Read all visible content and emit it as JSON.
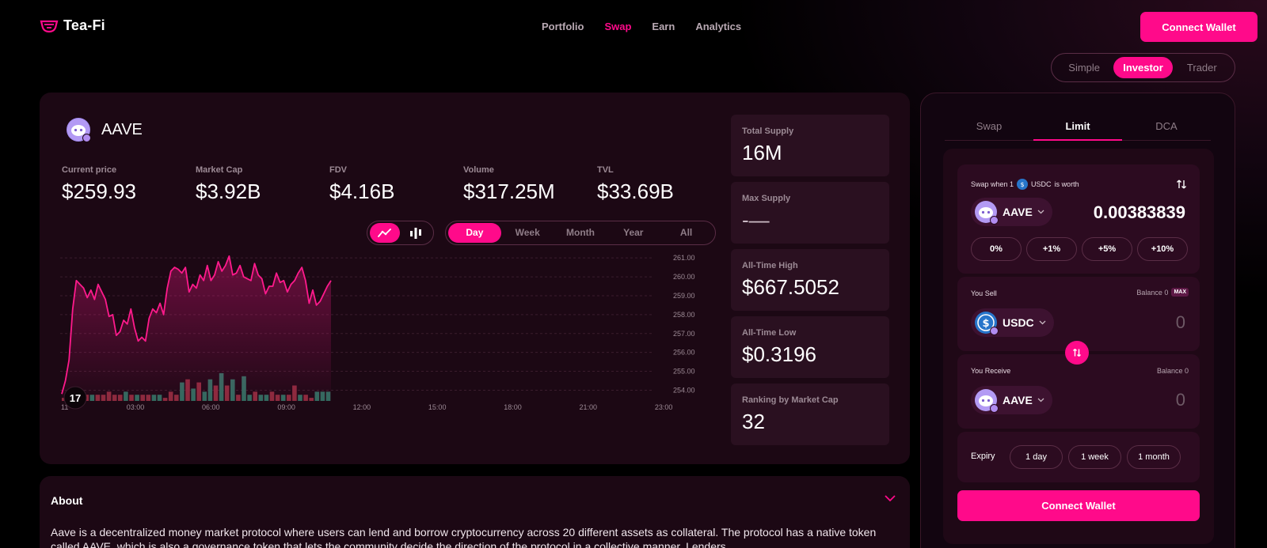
{
  "brand": {
    "name_part1": "Tea",
    "name_part2": "-Fi",
    "accent": "#ff0a8a"
  },
  "nav": {
    "items": [
      "Portfolio",
      "Swap",
      "Earn",
      "Analytics"
    ],
    "active": "Swap"
  },
  "header": {
    "connect_label": "Connect Wallet"
  },
  "modes": {
    "items": [
      "Simple",
      "Investor",
      "Trader"
    ],
    "active": "Investor"
  },
  "token": {
    "symbol": "AAVE",
    "stats": [
      {
        "label": "Current price",
        "value": "$259.93"
      },
      {
        "label": "Market Cap",
        "value": "$3.92B"
      },
      {
        "label": "FDV",
        "value": "$4.16B"
      },
      {
        "label": "Volume",
        "value": "$317.25M"
      },
      {
        "label": "TVL",
        "value": "$33.69B"
      }
    ],
    "side_stats": [
      {
        "label": "Total Supply",
        "value": "16M"
      },
      {
        "label": "Max Supply",
        "value": "-—"
      },
      {
        "label": "All-Time High",
        "value": "$667.5052"
      },
      {
        "label": "All-Time Low",
        "value": "$0.3196"
      },
      {
        "label": "Ranking by Market Cap",
        "value": "32"
      }
    ]
  },
  "chart_controls": {
    "types": [
      "line-chart-icon",
      "candle-chart-icon"
    ],
    "active_type": "line-chart-icon",
    "ranges": [
      "Day",
      "Week",
      "Month",
      "Year",
      "All"
    ],
    "active_range": "Day"
  },
  "chart_data": {
    "type": "line",
    "y_ticks": [
      "261.00",
      "260.00",
      "259.00",
      "258.00",
      "257.00",
      "256.00",
      "255.00",
      "254.00"
    ],
    "ylim": [
      253.6,
      261.3
    ],
    "x_ticks": [
      "03:00",
      "06:00",
      "09:00",
      "12:00",
      "15:00",
      "18:00",
      "21:00",
      "23:00"
    ],
    "x_first_tick_partial": "11",
    "price": [
      253.8,
      254.5,
      255.6,
      258.3,
      259.8,
      259.6,
      259.4,
      258.9,
      259.3,
      258.8,
      259.6,
      259.2,
      258.8,
      257.9,
      258.0,
      256.9,
      257.1,
      257.7,
      257.5,
      258.3,
      257.3,
      256.6,
      256.8,
      256.6,
      257.8,
      258.3,
      258.1,
      258.6,
      258.0,
      259.4,
      260.3,
      260.5,
      260.4,
      260.2,
      260.5,
      259.2,
      259.6,
      259.4,
      260.1,
      259.8,
      260.6,
      259.8,
      260.1,
      260.8,
      260.3,
      260.6,
      261.1,
      260.1,
      260.2,
      260.6,
      260.0,
      259.9,
      259.8,
      260.7,
      260.1,
      259.9,
      259.1,
      259.5,
      259.5,
      260.2,
      259.7,
      259.8,
      259.2,
      259.6,
      259.8,
      260.2,
      260.5,
      259.8,
      258.6,
      259.3,
      258.5,
      258.7,
      259.1,
      259.5,
      259.8
    ],
    "volume_bars": [
      {
        "v": 1,
        "up": false
      },
      {
        "v": 2,
        "up": false
      },
      {
        "v": 2,
        "up": false
      },
      {
        "v": 2,
        "up": true
      },
      {
        "v": 2,
        "up": false
      },
      {
        "v": 2,
        "up": true
      },
      {
        "v": 2,
        "up": false
      },
      {
        "v": 2,
        "up": false
      },
      {
        "v": 3,
        "up": false
      },
      {
        "v": 2,
        "up": false
      },
      {
        "v": 2,
        "up": false
      },
      {
        "v": 3,
        "up": true
      },
      {
        "v": 2,
        "up": false
      },
      {
        "v": 2,
        "up": true
      },
      {
        "v": 2,
        "up": false
      },
      {
        "v": 2,
        "up": false
      },
      {
        "v": 2,
        "up": true
      },
      {
        "v": 2,
        "up": true
      },
      {
        "v": 1,
        "up": false
      },
      {
        "v": 3,
        "up": false
      },
      {
        "v": 2,
        "up": false
      },
      {
        "v": 6,
        "up": true
      },
      {
        "v": 7,
        "up": false
      },
      {
        "v": 4,
        "up": true
      },
      {
        "v": 6,
        "up": false
      },
      {
        "v": 3,
        "up": true
      },
      {
        "v": 7,
        "up": true
      },
      {
        "v": 5,
        "up": false
      },
      {
        "v": 9,
        "up": true
      },
      {
        "v": 5,
        "up": false
      },
      {
        "v": 7,
        "up": true
      },
      {
        "v": 2,
        "up": false
      },
      {
        "v": 8,
        "up": true
      },
      {
        "v": 2,
        "up": true
      },
      {
        "v": 3,
        "up": false
      },
      {
        "v": 2,
        "up": true
      },
      {
        "v": 2,
        "up": true
      },
      {
        "v": 3,
        "up": false
      },
      {
        "v": 2,
        "up": false
      },
      {
        "v": 2,
        "up": true
      },
      {
        "v": 2,
        "up": false
      },
      {
        "v": 5,
        "up": false
      },
      {
        "v": 2,
        "up": true
      },
      {
        "v": 2,
        "up": false
      },
      {
        "v": 1,
        "up": false
      },
      {
        "v": 3,
        "up": true
      },
      {
        "v": 3,
        "up": true
      },
      {
        "v": 3,
        "up": true
      }
    ],
    "colors": {
      "line": "#ff1a8c",
      "up": "#2f6b5e",
      "down": "#8a2a3c",
      "grid": "#3a1c2d"
    }
  },
  "about": {
    "title": "About",
    "text": "Aave is a decentralized money market protocol where users can lend and borrow cryptocurrency across 20 different assets as collateral. The protocol has a native token called AAVE, which is also a governance token that lets the community decide the direction of the protocol in a collective manner. Lenders"
  },
  "swap": {
    "tabs": [
      "Swap",
      "Limit",
      "DCA"
    ],
    "active_tab": "Limit",
    "limit_header_prefix": "Swap when 1",
    "limit_header_token": "USDC",
    "limit_header_suffix": "is worth",
    "limit_token": "AAVE",
    "limit_price": "0.00383839",
    "pct_buttons": [
      "0%",
      "+1%",
      "+5%",
      "+10%"
    ],
    "sell_label": "You Sell",
    "sell_balance": "Balance 0",
    "max_label": "MAX",
    "sell_token": "USDC",
    "sell_amount": "0",
    "receive_label": "You Receive",
    "receive_balance": "Balance 0",
    "receive_token": "AAVE",
    "receive_amount": "0",
    "expiry_label": "Expiry",
    "expiry_options": [
      "1 day",
      "1 week",
      "1 month"
    ],
    "connect_label": "Connect Wallet"
  }
}
